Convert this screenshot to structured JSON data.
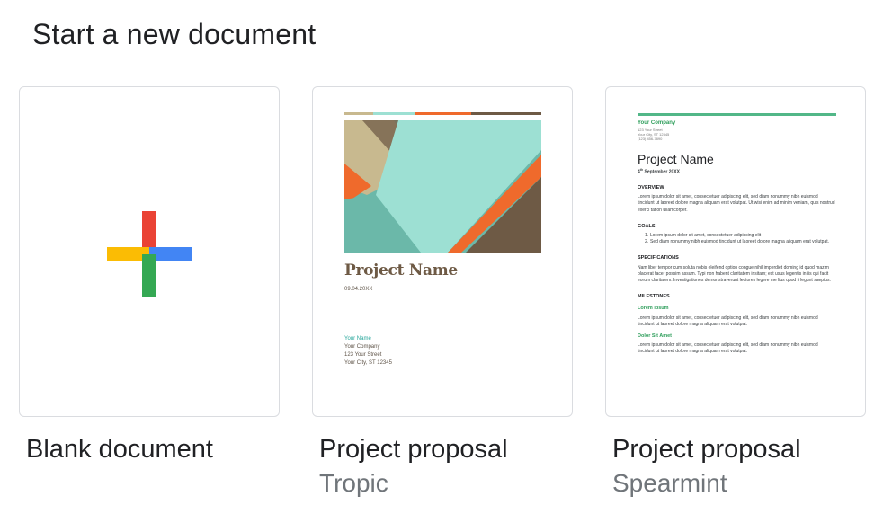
{
  "heading": "Start a new document",
  "templates": [
    {
      "title": "Blank document",
      "subtitle": ""
    },
    {
      "title": "Project proposal",
      "subtitle": "Tropic"
    },
    {
      "title": "Project proposal",
      "subtitle": "Spearmint"
    }
  ],
  "tropic_preview": {
    "project_name": "Project Name",
    "date": "09.04.20XX",
    "contact_name": "Your Name",
    "company": "Your Company",
    "street": "123 Your Street",
    "city": "Your City, ST 12345"
  },
  "spearmint_preview": {
    "company": "Your Company",
    "street": "123 Your Street",
    "city": "Your City, ST 12345",
    "phone": "(123) 456-7890",
    "project_name": "Project Name",
    "date_day": "4",
    "date_suffix": "th",
    "date_rest": " September 20XX",
    "overview_heading": "OVERVIEW",
    "overview_text": "Lorem ipsum dolor sit amet, consectetuer adipiscing elit, sed diam nonummy nibh euismod tincidunt ut laoreet dolore magna aliquam erat volutpat. Ut wisi enim ad minim veniam, quis nostrud exerci tation ullamcorper.",
    "goals_heading": "GOALS",
    "goal_1": "Lorem ipsum dolor sit amet, consectetuer adipiscing elit",
    "goal_2": "Sed diam nonummy nibh euismod tincidunt ut laoreet dolore magna aliquam erat volutpat.",
    "specs_heading": "SPECIFICATIONS",
    "specs_text": "Nam liber tempor cum soluta nobis eleifend option congue nihil imperdiet doming id quod mazim placerat facer possim assum. Typi non habent claritatem insitam; est usus legentis in iis qui facit eorum claritatem. Investigationes demonstraverunt lectores legere me lius quod ii legunt saepius.",
    "milestones_heading": "MILESTONES",
    "milestone_1_title": "Lorem Ipsum",
    "milestone_1_text": "Lorem ipsum dolor sit amet, consectetuer adipiscing elit, sed diam nonummy nibh euismod tincidunt ut laoreet dolore magna aliquam erat volutpat.",
    "milestone_2_title": "Dolor Sit Amet",
    "milestone_2_text": "Lorem ipsum dolor sit amet, consectetuer adipiscing elit, sed diam nonummy nibh euismod tincidunt ut laoreet dolore magna aliquam erat volutpat."
  },
  "colors": {
    "plus_red": "#ea4335",
    "plus_yellow": "#fbbc04",
    "plus_blue": "#4285f4",
    "plus_green": "#34a853",
    "spearmint_accent": "#52b788",
    "tropic_brown": "#6e5a45"
  },
  "icons": {
    "blank": "plus-icon"
  }
}
